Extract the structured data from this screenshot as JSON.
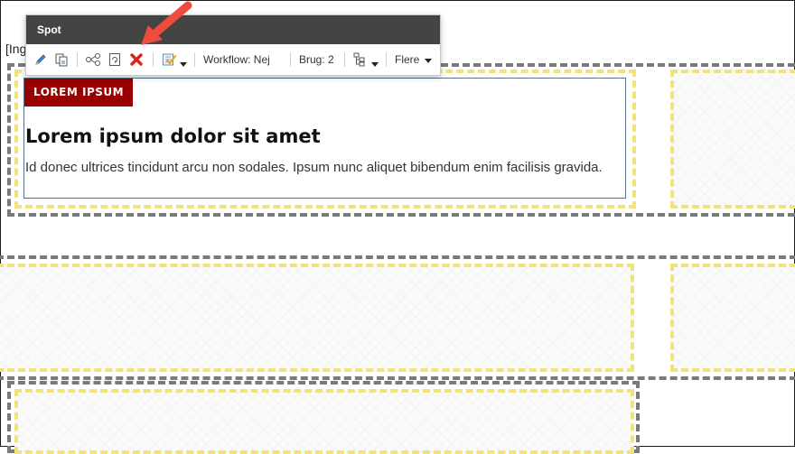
{
  "page": {
    "partial_text": "[Ing"
  },
  "toolbar": {
    "title": "Spot",
    "tools": [
      {
        "icon": "pencil-edit-icon"
      },
      {
        "icon": "copy-page-icon"
      },
      {
        "icon": "structure-icon"
      },
      {
        "icon": "refresh-page-icon"
      },
      {
        "icon": "delete-x-icon",
        "color": "#dd1f1f"
      },
      {
        "icon": "approve-checklist-icon"
      }
    ],
    "workflow_label": "Workflow: Nej",
    "brug_label": "Brug: 2",
    "hierarchy_icon": "hierarchy-tree-icon",
    "more_label": "Flere"
  },
  "teaser": {
    "badge": "LOREM IPSUM",
    "headline": "Lorem ipsum dolor sit amet",
    "body": "Id donec ultrices tincidunt arcu non sodales. Ipsum nunc aliquet bibendum enim facilisis gravida."
  },
  "colors": {
    "badge_bg": "#990000",
    "toolbar_header": "#444444",
    "arrow": "#f04c3e",
    "gray_dash": "#7a7a7a",
    "yellow_dash": "#f1e37c"
  }
}
